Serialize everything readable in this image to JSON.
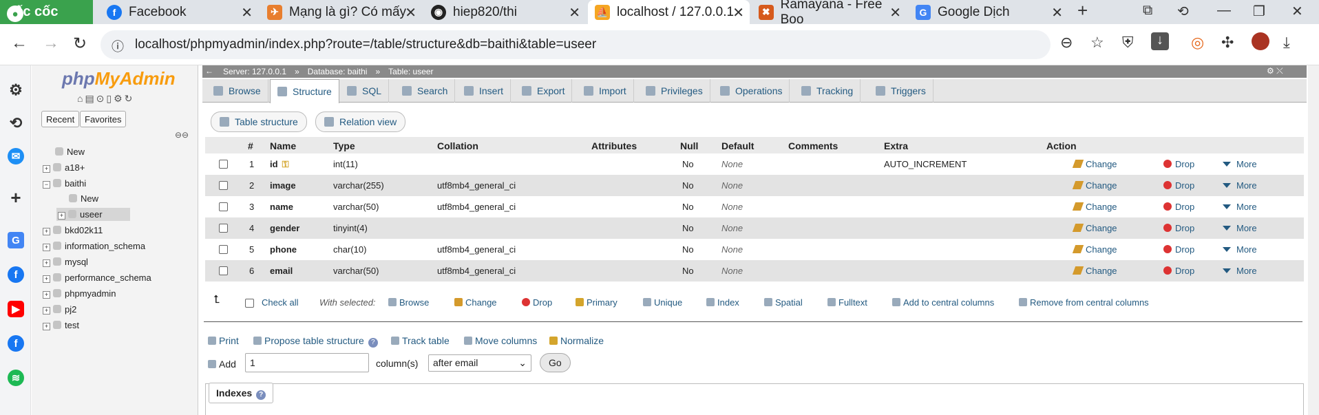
{
  "browser": {
    "brand": "cốc cốc",
    "tabs": [
      {
        "title": "Facebook",
        "icon": "facebook-icon"
      },
      {
        "title": "Mạng là gì? Có mấy",
        "icon": "bird-icon"
      },
      {
        "title": "hiep820/thi",
        "icon": "github-icon"
      },
      {
        "title": "localhost / 127.0.0.1",
        "icon": "phpmyadmin-icon"
      },
      {
        "title": "Ramayana - Free Boo",
        "icon": "book-icon"
      },
      {
        "title": "Google Dịch",
        "icon": "translate-icon"
      }
    ],
    "new_tab": "+",
    "url": "localhost/phpmyadmin/index.php?route=/table/structure&db=baithi&table=useer"
  },
  "nav": {
    "logo_php": "php",
    "logo_myadmin": "MyAdmin",
    "recent": "Recent",
    "favorites": "Favorites",
    "tree": [
      {
        "label": "New",
        "level": 1
      },
      {
        "label": "a18+",
        "level": 0
      },
      {
        "label": "baithi",
        "level": 0
      },
      {
        "label": "New",
        "level": 2
      },
      {
        "label": "useer",
        "level": 2
      },
      {
        "label": "bkd02k11",
        "level": 0
      },
      {
        "label": "information_schema",
        "level": 0
      },
      {
        "label": "mysql",
        "level": 0
      },
      {
        "label": "performance_schema",
        "level": 0
      },
      {
        "label": "phpmyadmin",
        "level": 0
      },
      {
        "label": "pj2",
        "level": 0
      },
      {
        "label": "test",
        "level": 0
      }
    ]
  },
  "breadcrumb": {
    "server": "Server: 127.0.0.1",
    "database": "Database: baithi",
    "table": "Table: useer"
  },
  "menu": [
    "Browse",
    "Structure",
    "SQL",
    "Search",
    "Insert",
    "Export",
    "Import",
    "Privileges",
    "Operations",
    "Tracking",
    "Triggers"
  ],
  "subtabs": [
    "Table structure",
    "Relation view"
  ],
  "table": {
    "headers": [
      "#",
      "Name",
      "Type",
      "Collation",
      "Attributes",
      "Null",
      "Default",
      "Comments",
      "Extra",
      "Action"
    ],
    "rows": [
      {
        "num": "1",
        "name": "id",
        "type": "int(11)",
        "collation": "",
        "null": "No",
        "default": "None",
        "extra": "AUTO_INCREMENT"
      },
      {
        "num": "2",
        "name": "image",
        "type": "varchar(255)",
        "collation": "utf8mb4_general_ci",
        "null": "No",
        "default": "None",
        "extra": ""
      },
      {
        "num": "3",
        "name": "name",
        "type": "varchar(50)",
        "collation": "utf8mb4_general_ci",
        "null": "No",
        "default": "None",
        "extra": ""
      },
      {
        "num": "4",
        "name": "gender",
        "type": "tinyint(4)",
        "collation": "",
        "null": "No",
        "default": "None",
        "extra": ""
      },
      {
        "num": "5",
        "name": "phone",
        "type": "char(10)",
        "collation": "utf8mb4_general_ci",
        "null": "No",
        "default": "None",
        "extra": ""
      },
      {
        "num": "6",
        "name": "email",
        "type": "varchar(50)",
        "collation": "utf8mb4_general_ci",
        "null": "No",
        "default": "None",
        "extra": ""
      }
    ],
    "actions": {
      "change": "Change",
      "drop": "Drop",
      "more": "More"
    }
  },
  "bulk": {
    "check_all": "Check all",
    "with_selected": "With selected:",
    "items": [
      "Browse",
      "Change",
      "Drop",
      "Primary",
      "Unique",
      "Index",
      "Spatial",
      "Fulltext",
      "Add to central columns",
      "Remove from central columns"
    ]
  },
  "tools": [
    "Print",
    "Propose table structure",
    "Track table",
    "Move columns",
    "Normalize"
  ],
  "add_columns": {
    "label": "Add",
    "count": "1",
    "unit": "column(s)",
    "position": "after email",
    "go": "Go"
  },
  "indexes": {
    "title": "Indexes"
  }
}
